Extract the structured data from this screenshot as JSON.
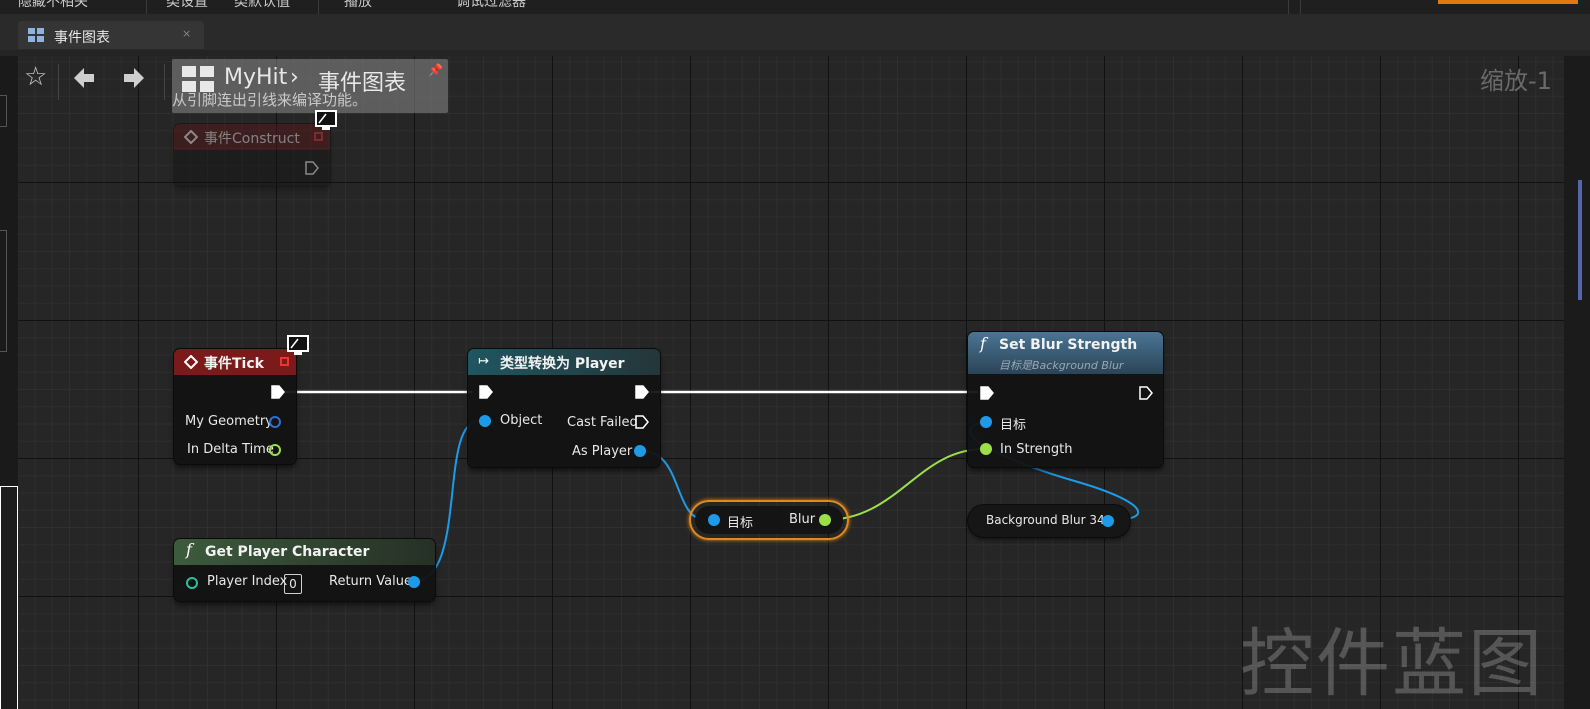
{
  "topbar": {
    "items": [
      "隐藏不相关",
      "类设置",
      "类默认值",
      "播放",
      "调试过滤器"
    ]
  },
  "tab": {
    "label": "事件图表",
    "close": "×"
  },
  "breadcrumb": {
    "app": "MyHit",
    "separator": "›",
    "page": "事件图表",
    "pin": "📌"
  },
  "hint": {
    "line2": "从引脚连出引线来编译功能。"
  },
  "zoom": "缩放-1",
  "watermark": "控件蓝图",
  "nodes": {
    "construct": {
      "title": "事件Construct"
    },
    "tick": {
      "title": "事件Tick",
      "pins": [
        "My Geometry",
        "In Delta Time"
      ]
    },
    "cast": {
      "title": "类型转换为 Player",
      "object": "Object",
      "cast_failed": "Cast Failed",
      "as_player": "As Player"
    },
    "set_blur": {
      "title": "Set Blur Strength",
      "subtitle": "目标是Background Blur",
      "target": "目标",
      "strength": "In Strength"
    },
    "get_blur": {
      "target": "目标",
      "output": "Blur"
    },
    "bg_blur": {
      "label": "Background Blur 34"
    },
    "get_player": {
      "title": "Get Player Character",
      "player_index": "Player Index",
      "player_index_value": "0",
      "return_value": "Return Value"
    }
  },
  "colors": {
    "event_header": "#7a1a1a",
    "cast_header": "#1f5660",
    "set_blur_header": "#3b5e78",
    "get_player_header": "#3d5b3d",
    "exec_wire": "#ffffff",
    "object_wire": "#1e9be8",
    "float_wire": "#9be04a",
    "selection": "#e08a1a"
  },
  "icons": {
    "favorite": "star-icon",
    "back": "arrow-left-icon",
    "forward": "arrow-right-icon",
    "graph": "graph-icon",
    "debug": "monitor-icon",
    "function": "function-icon",
    "event": "event-diamond-icon",
    "cast": "cast-arrows-icon"
  }
}
